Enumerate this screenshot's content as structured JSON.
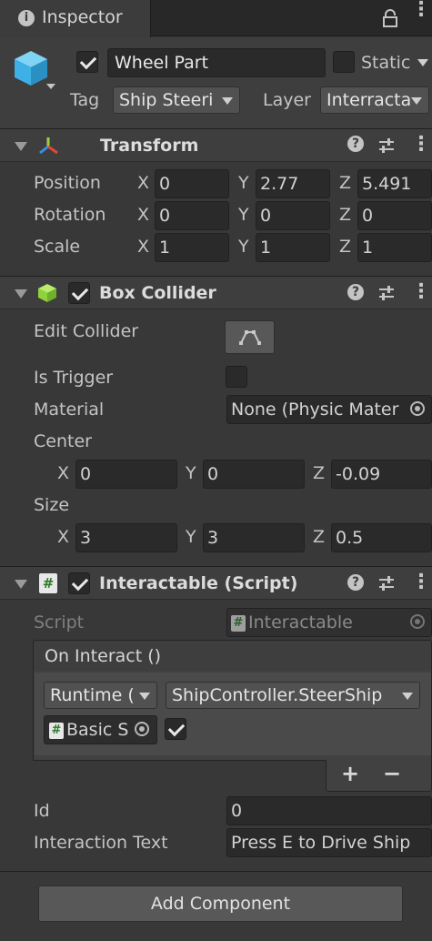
{
  "tab": {
    "title": "Inspector"
  },
  "gameobject": {
    "name": "Wheel Part",
    "active": true,
    "static_label": "Static",
    "static_checked": false,
    "tag_label": "Tag",
    "tag_value": "Ship Steeri",
    "layer_label": "Layer",
    "layer_value": "Interracta"
  },
  "transform": {
    "title": "Transform",
    "position_label": "Position",
    "rotation_label": "Rotation",
    "scale_label": "Scale",
    "position": {
      "x": "0",
      "y": "2.77",
      "z": "5.491"
    },
    "rotation": {
      "x": "0",
      "y": "0",
      "z": "0"
    },
    "scale": {
      "x": "1",
      "y": "1",
      "z": "1"
    }
  },
  "axis": {
    "x": "X",
    "y": "Y",
    "z": "Z"
  },
  "box_collider": {
    "title": "Box Collider",
    "enabled": true,
    "edit_collider_label": "Edit Collider",
    "is_trigger_label": "Is Trigger",
    "is_trigger": false,
    "material_label": "Material",
    "material_value": "None (Physic Mater",
    "center_label": "Center",
    "center": {
      "x": "0",
      "y": "0",
      "z": "-0.09"
    },
    "size_label": "Size",
    "size": {
      "x": "3",
      "y": "3",
      "z": "0.5"
    }
  },
  "interactable": {
    "title": "Interactable (Script)",
    "enabled": true,
    "script_label": "Script",
    "script_value": "Interactable",
    "event_title": "On Interact ()",
    "runtime_value": "Runtime (",
    "function_value": "ShipController.SteerShip",
    "object_value": "Basic S",
    "arg_checked": true,
    "plus": "+",
    "minus": "−",
    "id_label": "Id",
    "id_value": "0",
    "interaction_text_label": "Interaction Text",
    "interaction_text_value": "Press E to Drive Ship"
  },
  "add_component": {
    "label": "Add Component"
  }
}
